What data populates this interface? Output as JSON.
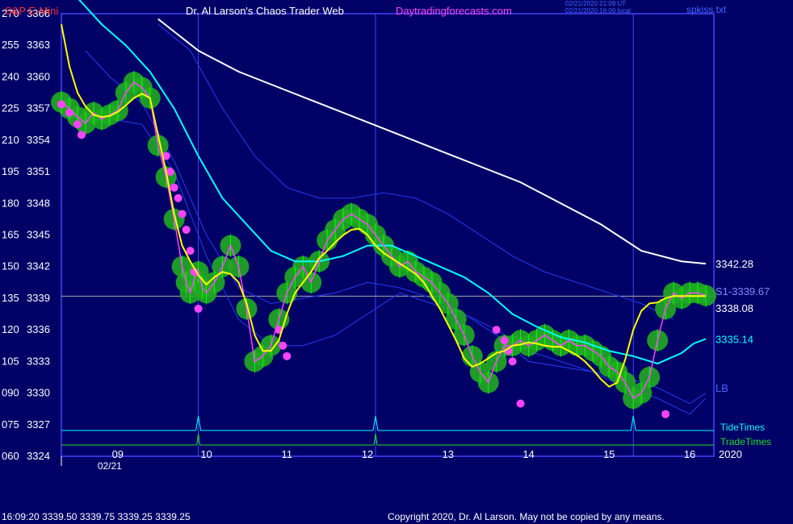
{
  "header": {
    "symbol": "S&P E-Mini",
    "title": "Dr. Al Larson's Chaos Trader Web",
    "site": "Daytradingforecasts.com",
    "time_utc": "02/21/2020 21:09 UT",
    "time_local": "02/21/2020 16:09 local",
    "filename": "spkiss.txt"
  },
  "footer": {
    "quote": "16:09:20  3339.50 3339.75 3339.25 3339.25",
    "copyright": "Copyright 2020, Dr. Al Larson. May not be copied by any means."
  },
  "colors": {
    "background": "#000066",
    "frame": "#4444ff",
    "price": "#ff44ff",
    "fast_ma": "#ffff00",
    "mid_ma": "#00ffff",
    "slow_ma": "#ffffff",
    "envelope": "#2233dd",
    "glow": "#22aa22",
    "bars": "#00ff00",
    "tide": "#00ffff",
    "trade": "#22dd22",
    "gridline": "#aaaaaa",
    "red_text": "#ff3333",
    "magenta_text": "#ff44ff"
  },
  "chart_data": {
    "type": "line",
    "ylim": [
      3324,
      3366
    ],
    "y_ticks": [
      {
        "left": "270",
        "price": "3366",
        "v": 3366
      },
      {
        "left": "255",
        "price": "3363",
        "v": 3363
      },
      {
        "left": "240",
        "price": "3360",
        "v": 3360
      },
      {
        "left": "225",
        "price": "3357",
        "v": 3357
      },
      {
        "left": "210",
        "price": "3354",
        "v": 3354
      },
      {
        "left": "195",
        "price": "3351",
        "v": 3351
      },
      {
        "left": "180",
        "price": "3348",
        "v": 3348
      },
      {
        "left": "165",
        "price": "3345",
        "v": 3345
      },
      {
        "left": "150",
        "price": "3342",
        "v": 3342
      },
      {
        "left": "135",
        "price": "3339",
        "v": 3339
      },
      {
        "left": "120",
        "price": "3336",
        "v": 3336
      },
      {
        "left": "105",
        "price": "3333",
        "v": 3333
      },
      {
        "left": "090",
        "price": "3330",
        "v": 3330
      },
      {
        "left": "075",
        "price": "3327",
        "v": 3327
      },
      {
        "left": "060",
        "price": "3324",
        "v": 3324
      }
    ],
    "xlim": [
      8.0,
      16.1
    ],
    "x_ticks": [
      {
        "label": "09",
        "v": 8.7
      },
      {
        "label": "10",
        "v": 9.8
      },
      {
        "label": "11",
        "v": 10.8
      },
      {
        "label": "12",
        "v": 11.8
      },
      {
        "label": "13",
        "v": 12.8
      },
      {
        "label": "14",
        "v": 13.8
      },
      {
        "label": "15",
        "v": 14.8
      },
      {
        "label": "16",
        "v": 15.8
      }
    ],
    "date_label": "02/21",
    "year_label": "2020",
    "vertical_lines_x": [
      9.7,
      11.9,
      15.1
    ],
    "horizontal_level": 3339.2,
    "series": [
      {
        "key": "price",
        "x": [
          8.0,
          8.1,
          8.2,
          8.3,
          8.4,
          8.5,
          8.6,
          8.7,
          8.8,
          8.9,
          9.0,
          9.1,
          9.2,
          9.3,
          9.4,
          9.5,
          9.55,
          9.6,
          9.65,
          9.7,
          9.75,
          9.8,
          9.9,
          10.0,
          10.1,
          10.2,
          10.3,
          10.4,
          10.5,
          10.6,
          10.7,
          10.8,
          10.9,
          11.0,
          11.1,
          11.2,
          11.3,
          11.4,
          11.5,
          11.6,
          11.7,
          11.8,
          11.9,
          12.0,
          12.1,
          12.2,
          12.3,
          12.4,
          12.5,
          12.6,
          12.7,
          12.8,
          12.9,
          13.0,
          13.1,
          13.2,
          13.3,
          13.4,
          13.5,
          13.6,
          13.7,
          13.8,
          13.9,
          14.0,
          14.1,
          14.2,
          14.3,
          14.4,
          14.5,
          14.6,
          14.7,
          14.8,
          14.9,
          15.0,
          15.1,
          15.2,
          15.3,
          15.4,
          15.5,
          15.6,
          15.7,
          15.8,
          15.9,
          16.0
        ],
        "y": [
          3357.6,
          3357.0,
          3356.2,
          3355.6,
          3356.6,
          3356.0,
          3356.4,
          3356.8,
          3358.5,
          3359.5,
          3359.0,
          3358.0,
          3353.5,
          3350.5,
          3346.5,
          3342.0,
          3340.5,
          3339.5,
          3340.8,
          3341.5,
          3340.0,
          3339.5,
          3340.5,
          3342.0,
          3344.0,
          3342.0,
          3338.0,
          3333.0,
          3333.5,
          3334.5,
          3337.0,
          3339.5,
          3341.0,
          3342.0,
          3340.5,
          3342.5,
          3344.5,
          3345.5,
          3346.5,
          3347.0,
          3346.5,
          3346.0,
          3345.0,
          3344.0,
          3343.0,
          3342.0,
          3342.5,
          3341.5,
          3341.0,
          3340.5,
          3339.5,
          3338.5,
          3337.0,
          3335.5,
          3333.5,
          3332.0,
          3331.0,
          3333.0,
          3334.5,
          3334.5,
          3335.0,
          3334.5,
          3335.0,
          3335.5,
          3335.0,
          3334.5,
          3335.0,
          3334.5,
          3334.5,
          3334.0,
          3333.5,
          3332.5,
          3332.0,
          3331.0,
          3329.5,
          3330.0,
          3331.5,
          3335.0,
          3338.0,
          3339.5,
          3339.0,
          3339.5,
          3339.5,
          3339.25
        ]
      },
      {
        "key": "fast_ma",
        "x": [
          8.0,
          8.1,
          8.2,
          8.3,
          8.4,
          8.5,
          8.6,
          8.7,
          8.8,
          8.9,
          9.0,
          9.1,
          9.2,
          9.3,
          9.4,
          9.5,
          9.6,
          9.7,
          9.8,
          9.9,
          10.0,
          10.1,
          10.2,
          10.3,
          10.4,
          10.5,
          10.6,
          10.7,
          10.8,
          10.9,
          11.0,
          11.1,
          11.2,
          11.3,
          11.4,
          11.5,
          11.6,
          11.7,
          11.8,
          11.9,
          12.0,
          12.1,
          12.2,
          12.3,
          12.4,
          12.5,
          12.6,
          12.7,
          12.8,
          12.9,
          13.0,
          13.1,
          13.2,
          13.3,
          13.4,
          13.5,
          13.6,
          13.7,
          13.8,
          13.9,
          14.0,
          14.1,
          14.2,
          14.3,
          14.4,
          14.5,
          14.6,
          14.7,
          14.8,
          14.9,
          15.0,
          15.1,
          15.2,
          15.3,
          15.4,
          15.5,
          15.6,
          15.7,
          15.8,
          15.9,
          16.0
        ],
        "y": [
          3365.0,
          3361.0,
          3358.5,
          3357.2,
          3356.4,
          3356.2,
          3356.3,
          3356.7,
          3357.3,
          3358.0,
          3358.4,
          3358.0,
          3354.5,
          3351.0,
          3347.0,
          3344.0,
          3342.5,
          3341.2,
          3340.3,
          3341.0,
          3341.5,
          3341.3,
          3340.5,
          3338.5,
          3335.5,
          3334.0,
          3334.0,
          3335.0,
          3337.5,
          3339.5,
          3340.5,
          3341.5,
          3342.8,
          3343.5,
          3344.3,
          3345.0,
          3345.5,
          3345.6,
          3345.0,
          3344.0,
          3343.3,
          3342.8,
          3342.3,
          3341.8,
          3341.3,
          3340.5,
          3339.2,
          3338.0,
          3336.5,
          3335.0,
          3333.3,
          3332.5,
          3332.8,
          3333.3,
          3333.8,
          3334.0,
          3334.5,
          3334.6,
          3334.8,
          3334.7,
          3334.5,
          3334.4,
          3334.4,
          3334.0,
          3333.6,
          3333.0,
          3332.2,
          3331.3,
          3330.6,
          3331.0,
          3333.2,
          3336.0,
          3337.8,
          3338.5,
          3338.6,
          3339.0,
          3339.2,
          3339.2,
          3339.2,
          3339.2,
          3339.2
        ]
      },
      {
        "key": "mid_ma",
        "x": [
          8.2,
          8.5,
          8.8,
          9.1,
          9.4,
          9.7,
          10.0,
          10.3,
          10.6,
          10.9,
          11.2,
          11.5,
          11.8,
          12.1,
          12.4,
          12.7,
          13.0,
          13.3,
          13.6,
          13.9,
          14.2,
          14.5,
          14.8,
          15.1,
          15.4,
          15.7,
          15.85,
          16.0
        ],
        "y": [
          3367.5,
          3365.0,
          3363.0,
          3360.5,
          3357.0,
          3352.5,
          3348.5,
          3346.0,
          3343.5,
          3342.5,
          3342.5,
          3343.0,
          3344.0,
          3344.0,
          3343.0,
          3342.0,
          3341.0,
          3339.5,
          3337.5,
          3336.3,
          3335.3,
          3334.8,
          3334.0,
          3333.5,
          3332.8,
          3333.8,
          3334.7,
          3335.14
        ]
      },
      {
        "key": "slow_ma",
        "x": [
          9.2,
          9.7,
          10.2,
          10.7,
          11.2,
          11.7,
          12.2,
          12.7,
          13.2,
          13.7,
          14.2,
          14.7,
          15.2,
          15.7,
          16.0
        ],
        "y": [
          3365.5,
          3362.5,
          3360.5,
          3359.0,
          3357.5,
          3356.0,
          3354.5,
          3353.0,
          3351.5,
          3350.0,
          3348.0,
          3346.0,
          3343.5,
          3342.5,
          3342.28
        ]
      },
      {
        "key": "upper_band",
        "x": [
          9.2,
          9.6,
          10.0,
          10.4,
          10.8,
          11.2,
          11.6,
          12.0,
          12.4,
          12.8,
          13.2,
          13.6,
          14.0,
          14.4,
          14.8,
          15.2,
          15.6
        ],
        "y": [
          3365.0,
          3362.5,
          3357.0,
          3352.5,
          3349.5,
          3348.5,
          3348.5,
          3349.0,
          3348.5,
          3347.0,
          3345.0,
          3343.0,
          3341.5,
          3340.5,
          3339.5,
          3338.5,
          3337.0
        ]
      },
      {
        "key": "mid_band",
        "x": [
          8.3,
          8.6,
          9.0,
          9.4,
          9.8,
          10.2,
          10.6,
          11.0,
          11.4,
          11.8,
          12.2,
          12.6,
          13.0,
          13.4,
          13.8,
          14.2,
          14.6,
          15.0,
          15.4,
          15.8,
          16.0
        ],
        "y": [
          3362.5,
          3360.0,
          3357.5,
          3352.0,
          3345.0,
          3340.0,
          3338.5,
          3339.0,
          3339.5,
          3340.5,
          3340.0,
          3339.0,
          3337.5,
          3335.5,
          3333.0,
          3332.5,
          3332.0,
          3331.5,
          3330.5,
          3329.0,
          3330.0
        ]
      },
      {
        "key": "lower_band",
        "x": [
          8.2,
          8.6,
          9.0,
          9.4,
          9.8,
          10.2,
          10.6,
          11.0,
          11.4,
          11.8,
          12.2,
          12.6,
          13.0,
          13.4,
          13.8,
          14.2,
          14.6,
          15.0,
          15.4,
          15.8,
          16.0
        ],
        "y": [
          3356.5,
          3356.0,
          3355.5,
          3351.0,
          3343.0,
          3337.0,
          3334.5,
          3334.5,
          3335.5,
          3337.5,
          3339.5,
          3338.5,
          3337.5,
          3336.0,
          3334.0,
          3333.0,
          3332.0,
          3330.5,
          3329.5,
          3328.0,
          3329.5
        ]
      }
    ],
    "magenta_dots": {
      "x": [
        8.0,
        8.1,
        8.2,
        8.25,
        9.3,
        9.35,
        9.4,
        9.45,
        9.5,
        9.55,
        9.6,
        9.65,
        9.7,
        10.7,
        10.75,
        10.8,
        13.4,
        13.5,
        13.55,
        13.6,
        13.7,
        15.5
      ],
      "y": [
        3357.4,
        3356.6,
        3355.5,
        3354.5,
        3352.5,
        3351.0,
        3349.5,
        3348.5,
        3347.0,
        3345.5,
        3343.5,
        3341.5,
        3338.0,
        3336.0,
        3334.5,
        3333.5,
        3336.0,
        3335.0,
        3334.0,
        3333.0,
        3329.0,
        3328.0
      ]
    },
    "right_labels": [
      {
        "text": "3342.28",
        "v": 3342.28,
        "color": "#ffffff"
      },
      {
        "text": "S1-3339.67",
        "v": 3339.67,
        "color": "#8888ff"
      },
      {
        "text": "3338.08",
        "v": 3338.08,
        "color": "#ffffff"
      },
      {
        "text": "3335.14",
        "v": 3335.14,
        "color": "#00ffff"
      },
      {
        "text": "LB",
        "v": 3330.5,
        "color": "#4466ff"
      }
    ],
    "legend": [
      {
        "text": "TideTimes",
        "color": "#00ffff"
      },
      {
        "text": "TradeTimes",
        "color": "#22dd22"
      }
    ]
  }
}
